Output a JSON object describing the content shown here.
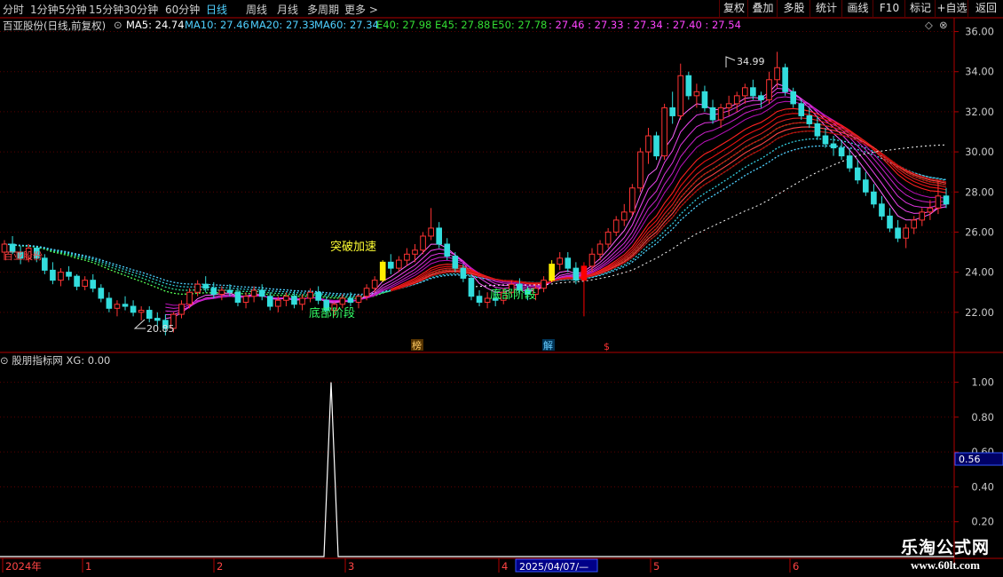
{
  "toolbar": {
    "periods": [
      "分时",
      "1分钟",
      "5分钟",
      "15分钟",
      "30分钟",
      "60分钟",
      "日线",
      "周线",
      "月线",
      "多周期",
      "更多"
    ],
    "active_period": "日线",
    "more_arrow": ">",
    "buttons": [
      "复权",
      "叠加",
      "多股",
      "统计",
      "画线",
      "F10",
      "标记",
      "+自选",
      "返回"
    ]
  },
  "chart_header": {
    "stock": "百亚股份(日线,前复权)",
    "ma_items": [
      {
        "label": "MA5: 24.74",
        "color": "#ffffff"
      },
      {
        "label": "MA10: 27.46",
        "color": "#4fd0ff"
      },
      {
        "label": "MA20: 27.33",
        "color": "#4fd0ff"
      },
      {
        "label": "MA60: 27.34",
        "color": "#4fd0ff"
      },
      {
        "label": "E40: 27.98",
        "color": "#33dd33"
      },
      {
        "label": "E45: 27.88",
        "color": "#33dd33"
      },
      {
        "label": "E50: 27.78",
        "color": "#33dd33"
      },
      {
        "label": ": 27.46 : 27.33 : 27.34 : 27.40 : 27.54",
        "color": "#ff44ff"
      }
    ]
  },
  "annotations": {
    "breakout": "突破加速",
    "bottom1": "底部阶段",
    "bottom2": "底部阶段",
    "high_price": "34.99",
    "low_price": "20.85",
    "left_label": "百亚股份",
    "event_bang": "榜",
    "event_jie": "解",
    "event_s": "$"
  },
  "indicator": {
    "title": "股朋指标网 XG: 0.00",
    "current_value_tag": "0.56"
  },
  "time_axis": {
    "labels": [
      "2024年",
      "1",
      "2",
      "3",
      "4",
      "5",
      "6"
    ],
    "cursor_date": "2025/04/07/—"
  },
  "watermark": {
    "line1": "乐淘公式网",
    "line2": "www.60lt.com"
  },
  "colors": {
    "up": "#ff3333",
    "down": "#33dddd",
    "grid": "#5a0000",
    "axis": "#b00000"
  },
  "chart_data": [
    {
      "type": "line",
      "title": "",
      "y_axis_ticks": [
        22.0,
        24.0,
        26.0,
        28.0,
        30.0,
        32.0,
        34.0,
        36.0
      ],
      "ylim": [
        20.0,
        36.6
      ],
      "candles": [
        [
          25.0,
          25.6,
          24.6,
          25.4
        ],
        [
          25.4,
          25.8,
          24.9,
          25.0
        ],
        [
          25.0,
          25.3,
          24.4,
          24.7
        ],
        [
          24.7,
          25.4,
          24.5,
          25.2
        ],
        [
          25.2,
          25.3,
          24.5,
          24.7
        ],
        [
          24.7,
          24.9,
          23.9,
          24.1
        ],
        [
          24.1,
          24.5,
          23.4,
          23.6
        ],
        [
          23.6,
          24.2,
          23.3,
          24.0
        ],
        [
          24.0,
          24.3,
          23.6,
          23.8
        ],
        [
          23.8,
          23.9,
          23.1,
          23.3
        ],
        [
          23.3,
          23.8,
          23.1,
          23.6
        ],
        [
          23.6,
          23.9,
          23.0,
          23.2
        ],
        [
          23.2,
          23.4,
          22.5,
          22.7
        ],
        [
          22.7,
          23.0,
          22.0,
          22.2
        ],
        [
          22.2,
          22.6,
          21.8,
          22.4
        ],
        [
          22.4,
          22.8,
          22.1,
          22.3
        ],
        [
          22.3,
          22.6,
          21.8,
          22.0
        ],
        [
          22.0,
          22.3,
          21.6,
          22.1
        ],
        [
          22.1,
          22.3,
          21.5,
          21.7
        ],
        [
          21.7,
          22.0,
          21.3,
          21.6
        ],
        [
          21.6,
          21.9,
          20.85,
          21.2
        ],
        [
          21.2,
          22.0,
          21.0,
          21.9
        ],
        [
          21.9,
          22.6,
          21.7,
          22.4
        ],
        [
          22.4,
          23.2,
          22.2,
          23.0
        ],
        [
          23.0,
          23.6,
          22.8,
          23.4
        ],
        [
          23.4,
          23.8,
          23.0,
          23.2
        ],
        [
          23.2,
          23.5,
          22.7,
          22.9
        ],
        [
          22.9,
          23.3,
          22.6,
          23.1
        ],
        [
          23.1,
          23.4,
          22.8,
          23.0
        ],
        [
          23.0,
          23.2,
          22.3,
          22.5
        ],
        [
          22.5,
          23.0,
          22.2,
          22.8
        ],
        [
          22.8,
          23.3,
          22.5,
          23.1
        ],
        [
          23.1,
          23.4,
          22.6,
          22.8
        ],
        [
          22.8,
          23.0,
          22.1,
          22.3
        ],
        [
          22.3,
          22.8,
          22.0,
          22.6
        ],
        [
          22.6,
          23.0,
          22.3,
          22.8
        ],
        [
          22.8,
          23.1,
          22.2,
          22.4
        ],
        [
          22.4,
          22.9,
          22.1,
          22.7
        ],
        [
          22.7,
          23.2,
          22.5,
          23.0
        ],
        [
          23.0,
          23.3,
          22.4,
          22.6
        ],
        [
          22.6,
          22.8,
          21.9,
          22.1
        ],
        [
          22.1,
          22.5,
          21.8,
          22.4
        ],
        [
          22.4,
          22.9,
          22.2,
          22.7
        ],
        [
          22.7,
          23.0,
          22.3,
          22.5
        ],
        [
          22.5,
          22.9,
          22.2,
          22.8
        ],
        [
          22.8,
          23.4,
          22.6,
          23.2
        ],
        [
          23.2,
          23.8,
          23.0,
          23.6
        ],
        [
          23.6,
          24.6,
          23.5,
          24.5
        ],
        [
          24.5,
          24.9,
          23.9,
          24.2
        ],
        [
          24.2,
          24.8,
          24.0,
          24.6
        ],
        [
          24.6,
          25.2,
          24.3,
          24.9
        ],
        [
          24.9,
          25.4,
          24.5,
          25.1
        ],
        [
          25.1,
          26.0,
          24.9,
          25.8
        ],
        [
          25.8,
          27.2,
          25.6,
          26.2
        ],
        [
          26.2,
          26.5,
          25.2,
          25.4
        ],
        [
          25.4,
          25.7,
          24.6,
          24.8
        ],
        [
          24.8,
          25.0,
          24.0,
          24.2
        ],
        [
          24.2,
          24.4,
          23.5,
          23.7
        ],
        [
          23.7,
          23.9,
          22.6,
          22.8
        ],
        [
          22.8,
          23.1,
          22.3,
          22.5
        ],
        [
          22.5,
          23.0,
          22.2,
          22.7
        ],
        [
          22.7,
          23.1,
          22.3,
          22.6
        ],
        [
          22.6,
          23.2,
          22.4,
          23.0
        ],
        [
          23.0,
          23.6,
          22.8,
          23.4
        ],
        [
          23.4,
          23.7,
          22.9,
          23.1
        ],
        [
          23.1,
          23.3,
          22.6,
          22.9
        ],
        [
          22.9,
          23.4,
          22.6,
          23.2
        ],
        [
          23.2,
          23.8,
          23.0,
          23.6
        ],
        [
          23.6,
          24.6,
          23.5,
          24.4
        ],
        [
          24.4,
          25.0,
          24.1,
          24.7
        ],
        [
          24.7,
          25.0,
          24.0,
          24.2
        ],
        [
          24.2,
          24.5,
          23.4,
          23.6
        ],
        [
          23.6,
          24.5,
          21.8,
          24.3
        ],
        [
          24.3,
          25.2,
          24.0,
          24.9
        ],
        [
          24.9,
          25.6,
          24.6,
          25.4
        ],
        [
          25.4,
          26.2,
          25.2,
          26.0
        ],
        [
          26.0,
          26.8,
          25.8,
          26.6
        ],
        [
          26.6,
          27.4,
          26.3,
          27.0
        ],
        [
          27.0,
          28.4,
          26.8,
          28.2
        ],
        [
          28.2,
          30.2,
          28.0,
          30.0
        ],
        [
          30.0,
          31.2,
          29.4,
          30.8
        ],
        [
          30.8,
          31.0,
          29.6,
          29.8
        ],
        [
          29.8,
          32.4,
          29.6,
          32.2
        ],
        [
          32.2,
          33.0,
          31.4,
          31.8
        ],
        [
          31.8,
          34.4,
          31.6,
          33.8
        ],
        [
          33.8,
          34.0,
          32.6,
          32.8
        ],
        [
          32.8,
          33.4,
          32.2,
          33.0
        ],
        [
          33.0,
          33.3,
          32.0,
          32.2
        ],
        [
          32.2,
          32.6,
          31.4,
          31.6
        ],
        [
          31.6,
          32.4,
          31.2,
          32.2
        ],
        [
          32.2,
          32.8,
          31.8,
          32.4
        ],
        [
          32.4,
          33.0,
          32.0,
          32.8
        ],
        [
          32.8,
          33.4,
          32.4,
          33.2
        ],
        [
          33.2,
          33.6,
          32.6,
          32.8
        ],
        [
          32.8,
          33.0,
          32.2,
          32.6
        ],
        [
          32.6,
          34.0,
          32.4,
          33.6
        ],
        [
          33.6,
          34.99,
          33.2,
          34.2
        ],
        [
          34.2,
          34.4,
          32.8,
          33.0
        ],
        [
          33.0,
          33.2,
          32.2,
          32.4
        ],
        [
          32.4,
          32.6,
          31.6,
          31.8
        ],
        [
          31.8,
          32.2,
          31.2,
          31.4
        ],
        [
          31.4,
          31.8,
          30.6,
          30.8
        ],
        [
          30.8,
          31.2,
          30.2,
          30.4
        ],
        [
          30.4,
          30.8,
          29.8,
          30.2
        ],
        [
          30.2,
          30.6,
          29.6,
          29.8
        ],
        [
          29.8,
          30.2,
          29.0,
          29.2
        ],
        [
          29.2,
          29.6,
          28.4,
          28.6
        ],
        [
          28.6,
          29.0,
          27.8,
          28.0
        ],
        [
          28.0,
          28.4,
          27.2,
          27.4
        ],
        [
          27.4,
          27.8,
          26.6,
          26.8
        ],
        [
          26.8,
          27.2,
          26.0,
          26.2
        ],
        [
          26.2,
          26.6,
          25.5,
          25.7
        ],
        [
          25.7,
          26.4,
          25.2,
          26.2
        ],
        [
          26.2,
          26.8,
          25.9,
          26.6
        ],
        [
          26.6,
          27.2,
          26.3,
          27.0
        ],
        [
          27.0,
          27.6,
          26.6,
          27.2
        ],
        [
          27.2,
          28.6,
          26.9,
          27.8
        ],
        [
          27.8,
          28.2,
          27.2,
          27.4
        ]
      ]
    },
    {
      "type": "line",
      "title": "",
      "name": "XG",
      "y_axis_ticks": [
        0.2,
        0.4,
        0.6,
        0.8,
        1.0
      ],
      "ylim": [
        0.0,
        1.1
      ],
      "spike_month_position": 2.85,
      "spike_value": 1.0
    }
  ]
}
